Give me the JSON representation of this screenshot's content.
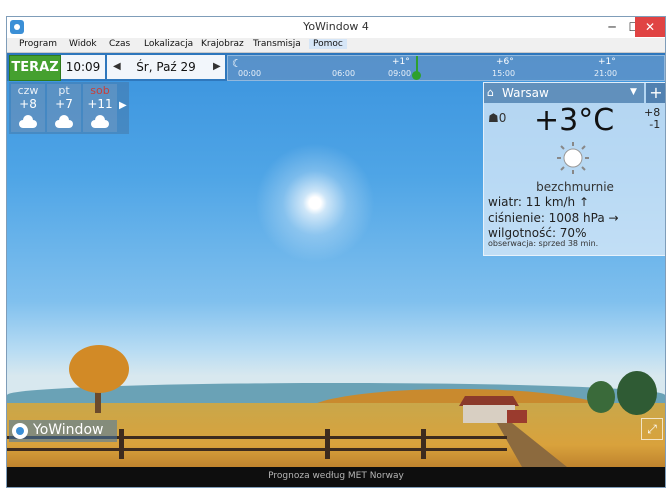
{
  "window": {
    "title": "YoWindow 4",
    "minimize": "─",
    "maximize": "☐",
    "close": "✕"
  },
  "menu": [
    "Program",
    "Widok",
    "Czas",
    "Lokalizacja",
    "Krajobraz",
    "Transmisja",
    "Pomoc"
  ],
  "toolbar": {
    "now_label": "TERAZ",
    "time": "10:09",
    "date": "Śr, Paź 29",
    "prev": "◀",
    "next": "▶"
  },
  "timeline": {
    "times": [
      "00:00",
      "06:00",
      "09:00",
      "15:00",
      "21:00"
    ],
    "temps": [
      "+1°",
      "+6°",
      "+1°"
    ]
  },
  "forecast": [
    {
      "day": "czw",
      "temp": "+8"
    },
    {
      "day": "pt",
      "temp": "+7"
    },
    {
      "day": "sob",
      "temp": "+11",
      "weekend": true
    }
  ],
  "panel": {
    "location": "Warsaw",
    "feels": "0",
    "temperature": "+3°C",
    "high": "+8",
    "low": "-1",
    "condition": "bezchmurnie",
    "wind": "wiatr:  11 km/h  ↑",
    "pressure": "ciśnienie:  1008 hPa →",
    "humidity": "wilgotność:  70%",
    "observation": "obserwacja:  sprzed 38 min."
  },
  "logo": "YoWindow",
  "status": "Prognoza według MET Norway",
  "colors": {
    "now_button": "#45a02f",
    "weekend": "#c7403a",
    "sky": "#4fa5e6"
  }
}
